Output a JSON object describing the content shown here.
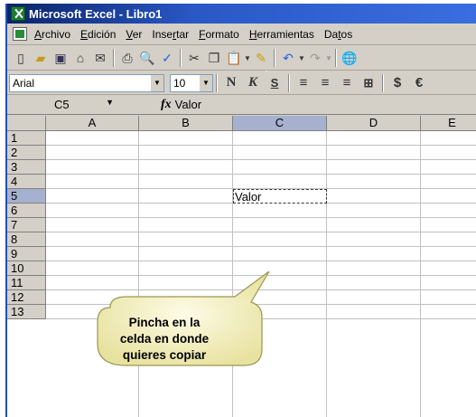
{
  "window": {
    "title": "Microsoft Excel - Libro1"
  },
  "menu": {
    "items": [
      {
        "label": "Archivo",
        "accel": "A"
      },
      {
        "label": "Edición",
        "accel": "E"
      },
      {
        "label": "Ver",
        "accel": "V"
      },
      {
        "label": "Insertar",
        "accel": "n"
      },
      {
        "label": "Formato",
        "accel": "F"
      },
      {
        "label": "Herramientas",
        "accel": "H"
      },
      {
        "label": "Datos",
        "accel": "t"
      }
    ]
  },
  "formatting": {
    "font": "Arial",
    "size": "10"
  },
  "formula_bar": {
    "name_box": "C5",
    "fx": "fx",
    "value": "Valor"
  },
  "sheet": {
    "columns": [
      "A",
      "B",
      "C",
      "D",
      "E"
    ],
    "selected_column": "C",
    "rows": [
      "1",
      "2",
      "3",
      "4",
      "5",
      "6",
      "7",
      "8",
      "9",
      "10",
      "11",
      "12",
      "13"
    ],
    "selected_row": "5",
    "cells": {
      "C5": "Valor"
    }
  },
  "callout": {
    "line1": "Pincha en la",
    "line2": "celda en donde",
    "line3": "quieres copiar"
  },
  "colors": {
    "title_start": "#0a246a",
    "title_end": "#3a6ee0",
    "chrome": "#d4d0c8",
    "selected_header": "#a5b1cf",
    "callout_fill": "#f7f3c2"
  }
}
